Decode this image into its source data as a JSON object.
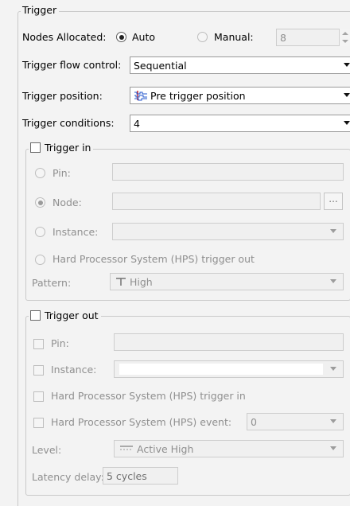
{
  "group_title": "Trigger",
  "nodes_allocated": {
    "label": "Nodes Allocated:",
    "auto_label": "Auto",
    "manual_label": "Manual:",
    "manual_value": "8"
  },
  "trigger_flow_control": {
    "label": "Trigger flow control:",
    "value": "Sequential"
  },
  "trigger_position": {
    "label": "Trigger position:",
    "value": "Pre trigger position"
  },
  "trigger_conditions": {
    "label": "Trigger conditions:",
    "value": "4"
  },
  "trigger_in": {
    "title": "Trigger in",
    "pin_label": "Pin:",
    "node_label": "Node:",
    "node_browse": "...",
    "instance_label": "Instance:",
    "hps_label": "Hard Processor System (HPS) trigger out",
    "pattern_label": "Pattern:",
    "pattern_value": "High"
  },
  "trigger_out": {
    "title": "Trigger out",
    "pin_label": "Pin:",
    "instance_label": "Instance:",
    "hps_trigger_label": "Hard Processor System (HPS) trigger in",
    "hps_event_label": "Hard Processor System (HPS) event:",
    "hps_event_value": "0",
    "level_label": "Level:",
    "level_value": "Active High",
    "latency_label": "Latency delay:",
    "latency_value": "5 cycles"
  }
}
